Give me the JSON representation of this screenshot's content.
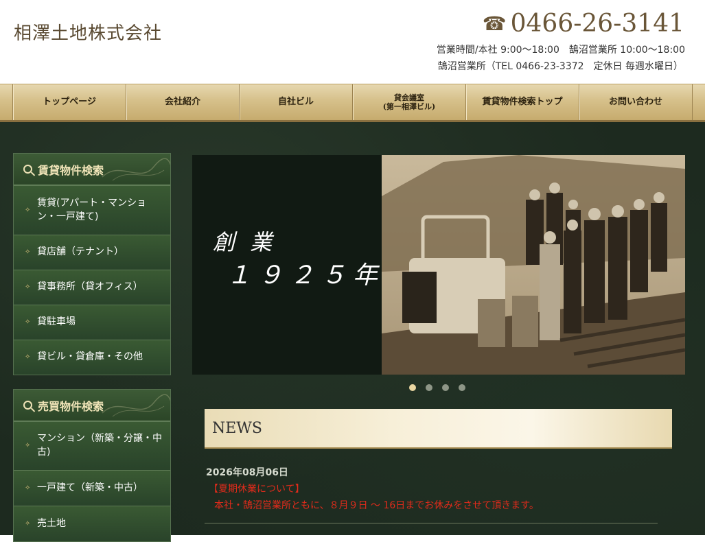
{
  "header": {
    "company_name": "相澤土地株式会社",
    "phone_icon": "telephone-icon",
    "phone_number": "0466-26-3141",
    "hours": "営業時間/本社 9:00～18:00　鵠沼営業所 10:00～18:00",
    "office_info": "鵠沼営業所（TEL 0466-23-3372　定休日 毎週水曜日）"
  },
  "nav": {
    "items": [
      {
        "label": "トップページ"
      },
      {
        "label": "会社紹介"
      },
      {
        "label": "自社ビル"
      },
      {
        "label": "貸会議室\n(第一相澤ビル)"
      },
      {
        "label": "賃貸物件検索トップ"
      },
      {
        "label": "お問い合わせ"
      }
    ]
  },
  "sidebar": {
    "rental": {
      "title": "賃貸物件検索",
      "icon": "search-icon",
      "items": [
        {
          "label": "賃貸(アパート・マンション・一戸建て)"
        },
        {
          "label": "貸店舗（テナント）"
        },
        {
          "label": "貸事務所（貸オフィス）"
        },
        {
          "label": "貸駐車場"
        },
        {
          "label": "貸ビル・貸倉庫・その他"
        }
      ]
    },
    "sale": {
      "title": "売買物件検索",
      "icon": "search-icon",
      "items": [
        {
          "label": "マンション（新築・分譲・中古)"
        },
        {
          "label": "一戸建て（新築・中古）"
        },
        {
          "label": "売土地"
        }
      ]
    }
  },
  "slider": {
    "caption_line1": "創 業",
    "caption_line2": "１９２５年",
    "slide_count": 4,
    "active_index": 0
  },
  "news": {
    "heading": "NEWS",
    "entries": [
      {
        "date": "2026年08月06日",
        "title": "【夏期休業について】",
        "body": "本社・鵠沼営業所ともに、８月９日 ～ 16日までお休みをさせて頂きます。"
      }
    ]
  },
  "colors": {
    "nav_gold": "#d6c08a",
    "sidebar_green": "#2f4a2c",
    "background_dark_green": "#1d2a1f",
    "news_text_red": "#e22b1b",
    "brand_brown": "#5a4a32"
  }
}
